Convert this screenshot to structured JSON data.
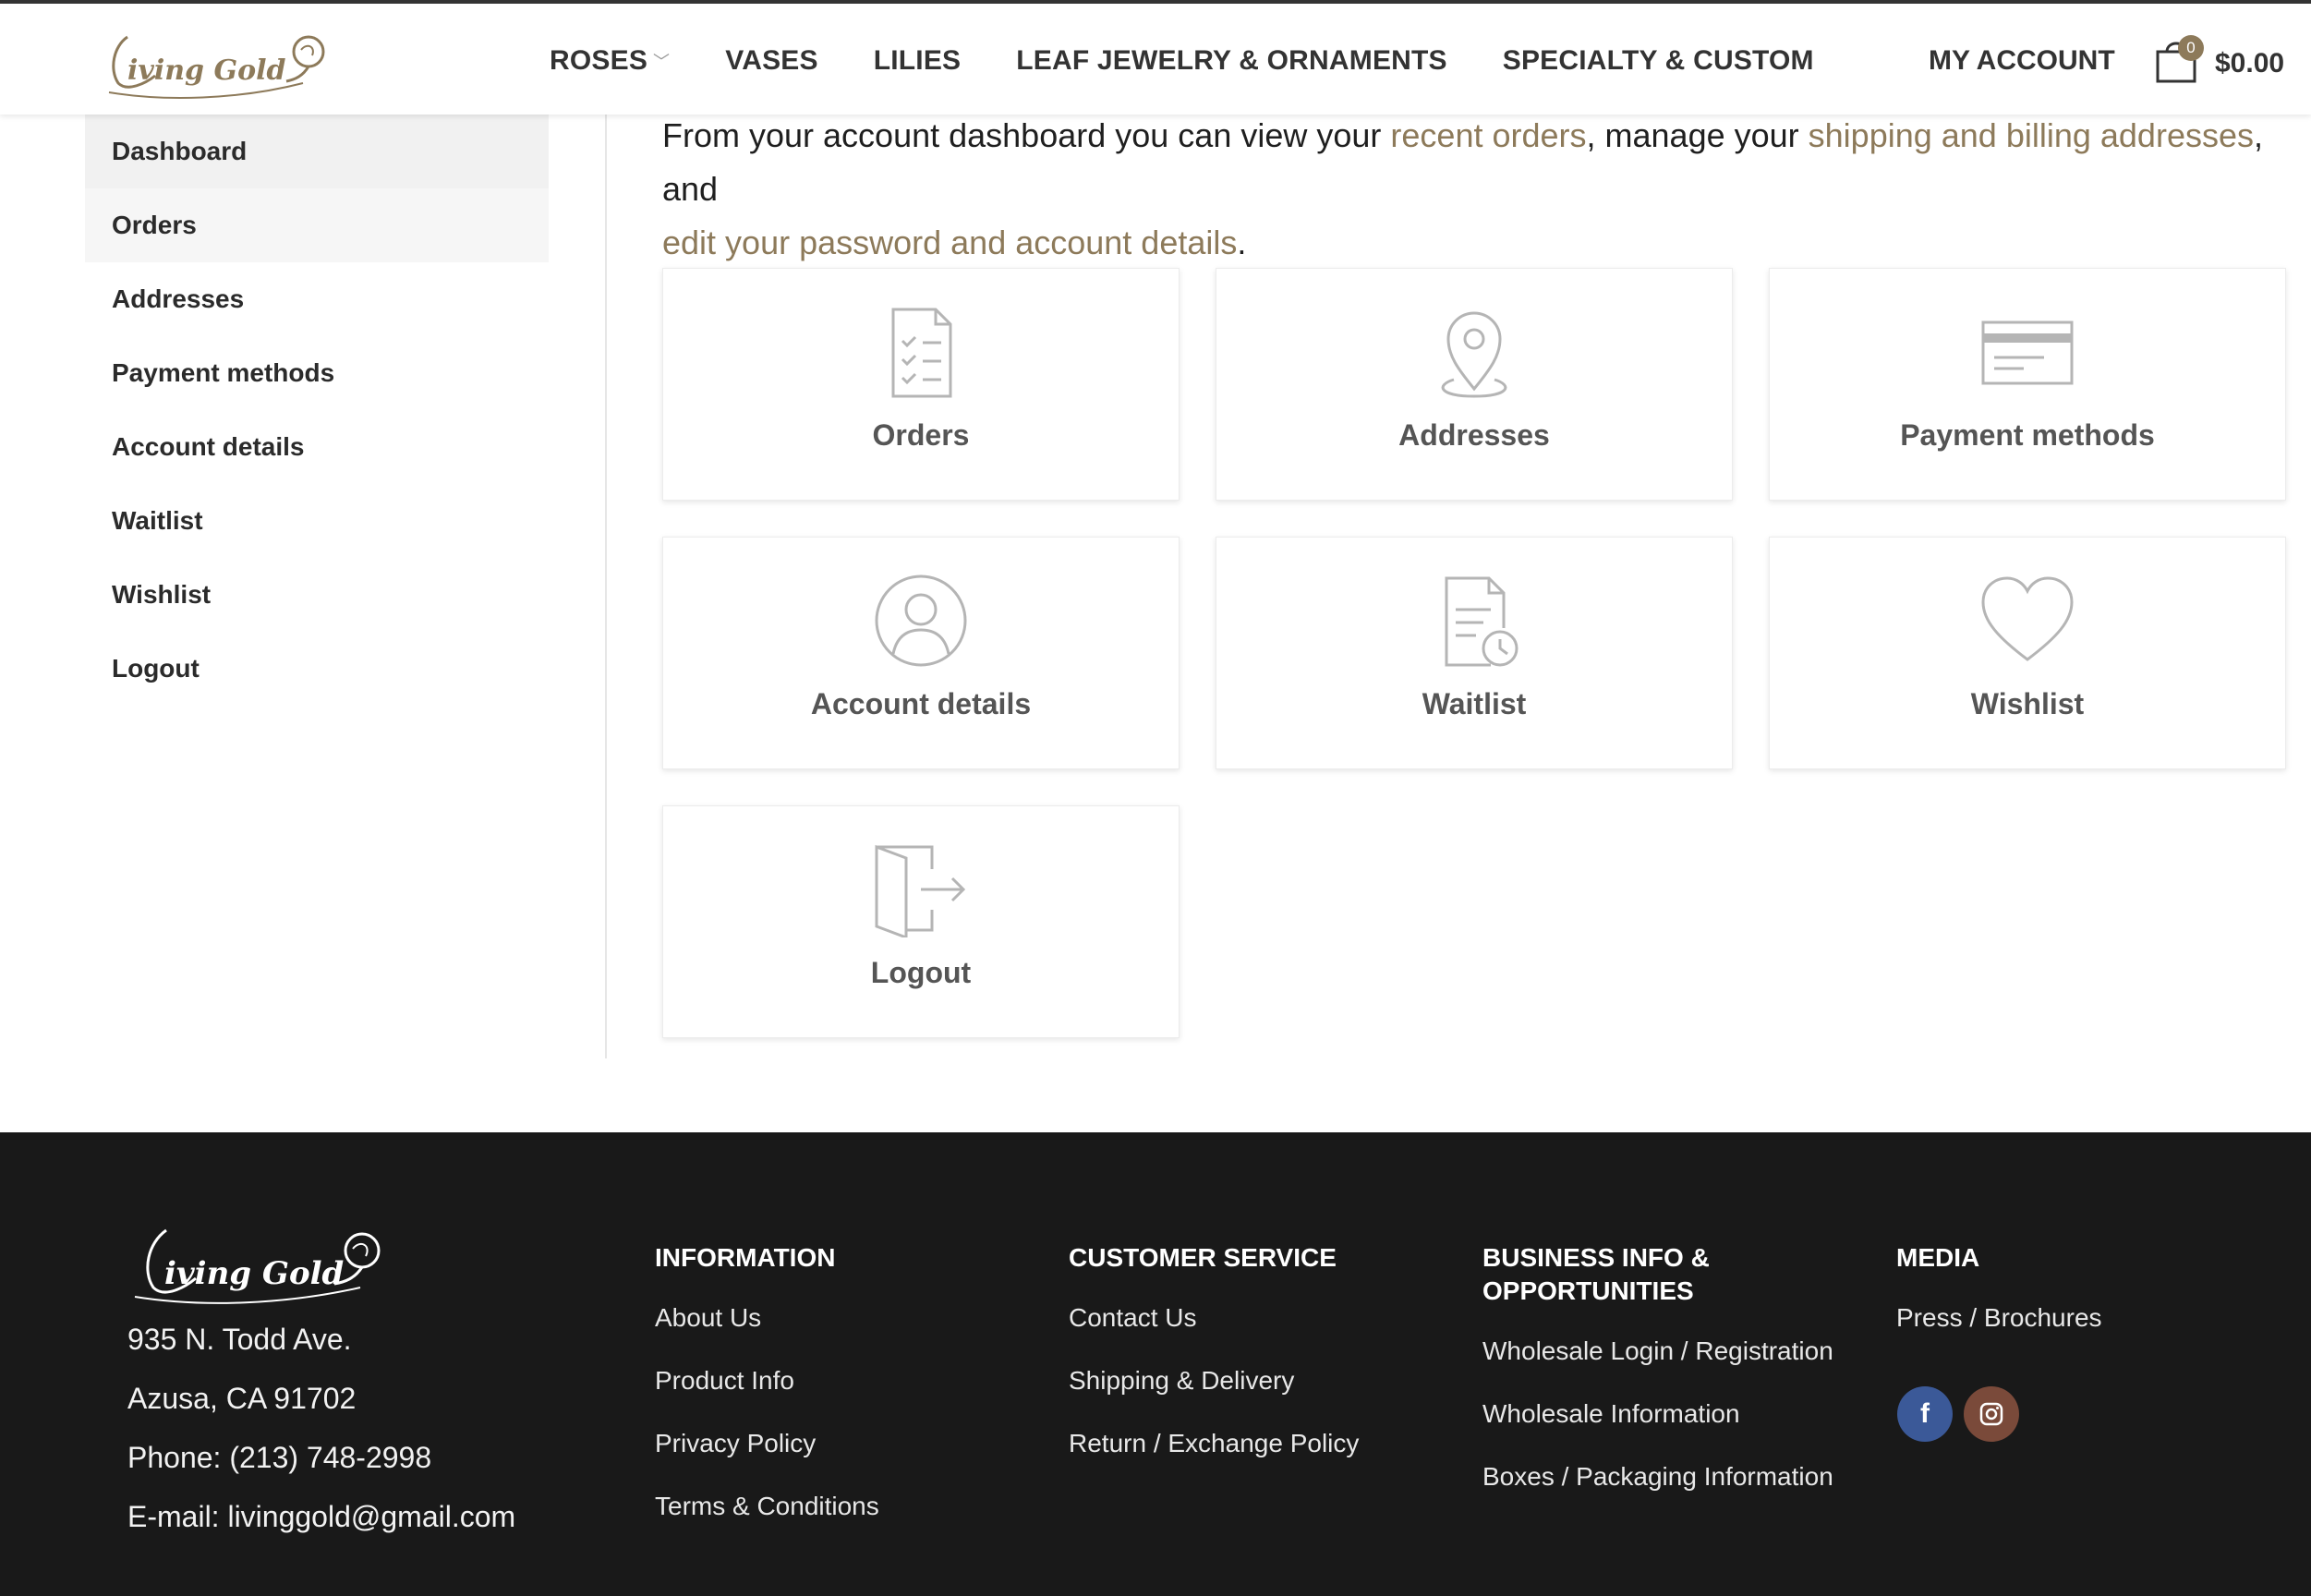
{
  "brand": {
    "name": "Living Gold"
  },
  "nav": {
    "items": [
      "ROSES",
      "VASES",
      "LILIES",
      "LEAF JEWELRY & ORNAMENTS",
      "SPECIALTY & CUSTOM"
    ],
    "account": "MY ACCOUNT",
    "cart_count": "0",
    "cart_total": "$0.00"
  },
  "sidebar": {
    "items": [
      {
        "label": "Dashboard"
      },
      {
        "label": "Orders"
      },
      {
        "label": "Addresses"
      },
      {
        "label": "Payment methods"
      },
      {
        "label": "Account details"
      },
      {
        "label": "Waitlist"
      },
      {
        "label": "Wishlist"
      },
      {
        "label": "Logout"
      }
    ]
  },
  "intro": {
    "t1": "From your account dashboard you can view your ",
    "l1": "recent orders",
    "t2": ", manage your ",
    "l2": "shipping and billing addresses",
    "t3": ", and",
    "l3": "edit your password and account details",
    "t4": "."
  },
  "tiles": [
    {
      "label": "Orders",
      "icon": "orders-icon"
    },
    {
      "label": "Addresses",
      "icon": "location-pin-icon"
    },
    {
      "label": "Payment methods",
      "icon": "credit-card-icon"
    },
    {
      "label": "Account details",
      "icon": "user-icon"
    },
    {
      "label": "Waitlist",
      "icon": "document-clock-icon"
    },
    {
      "label": "Wishlist",
      "icon": "heart-icon"
    },
    {
      "label": "Logout",
      "icon": "logout-door-icon"
    }
  ],
  "footer": {
    "address": {
      "line1": "935 N. Todd Ave.",
      "line2": "Azusa, CA 91702",
      "phone": "Phone: (213) 748-2998",
      "email": "E-mail: livinggold@gmail.com"
    },
    "information": {
      "heading": "INFORMATION",
      "links": [
        "About Us",
        "Product Info",
        "Privacy Policy",
        "Terms & Conditions"
      ]
    },
    "customer_service": {
      "heading": "CUSTOMER SERVICE",
      "links": [
        "Contact Us",
        "Shipping & Delivery",
        "Return / Exchange Policy"
      ]
    },
    "business": {
      "heading_line1": "BUSINESS INFO &",
      "heading_line2": "OPPORTUNITIES",
      "links": [
        "Wholesale Login / Registration",
        "Wholesale Information",
        "Boxes / Packaging Information"
      ]
    },
    "media": {
      "heading": "MEDIA",
      "links": [
        "Press / Brochures"
      ]
    }
  },
  "colors": {
    "accent": "#8d7a5a",
    "facebook": "#3b5998",
    "instagram": "#7a4a3a",
    "footer_bg": "#191919"
  }
}
